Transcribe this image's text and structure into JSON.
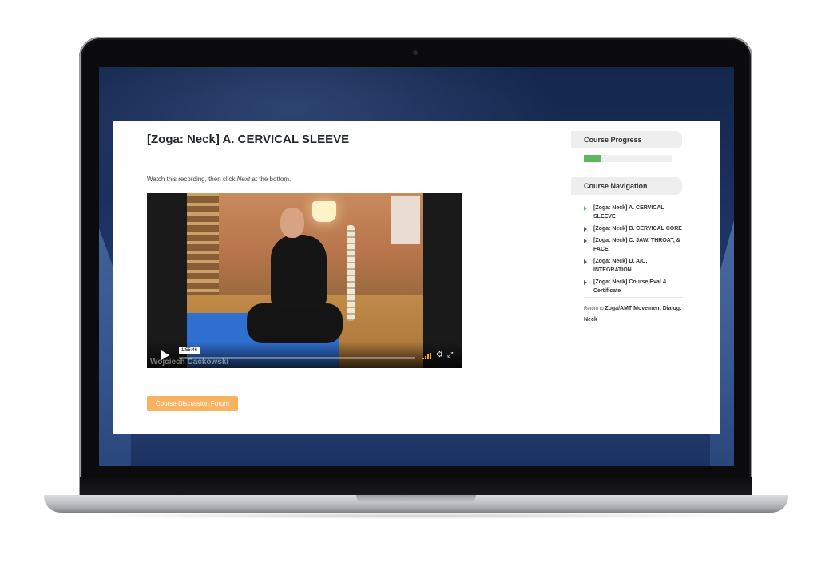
{
  "lesson": {
    "title": "[Zoga: Neck] A. CERVICAL SLEEVE",
    "instruction_prefix": "Watch this recording, then click ",
    "instruction_emphasis": "Next",
    "instruction_suffix": " at the bottom."
  },
  "video": {
    "timestamp": "1:55:46",
    "watermark": "Wojciech Cackowski",
    "icons": [
      "play-icon",
      "volume-icon",
      "settings-icon",
      "fullscreen-icon"
    ]
  },
  "forum_button_label": "Course Discussion Forum",
  "sidebar": {
    "progress_heading": "Course Progress",
    "progress_fraction": 0.2,
    "navigation_heading": "Course Navigation",
    "nav_items": [
      {
        "label": "[Zoga: Neck] A. CERVICAL SLEEVE",
        "current": true
      },
      {
        "label": "[Zoga: Neck] B. CERVICAL CORE",
        "current": false
      },
      {
        "label": "[Zoga: Neck] C. JAW, THROAT, & FACE",
        "current": false
      },
      {
        "label": "[Zoga: Neck] D. A/O, INTEGRATION",
        "current": false
      },
      {
        "label": "[Zoga: Neck] Course Eval & Certificate",
        "current": false
      }
    ],
    "return_prefix": "Return to ",
    "return_link": "Zoga/AMT Movement Dialog: Neck"
  },
  "colors": {
    "progress_fill": "#5cb85c",
    "forum_button": "#f9b360",
    "current_arrow": "#5cb85c"
  }
}
